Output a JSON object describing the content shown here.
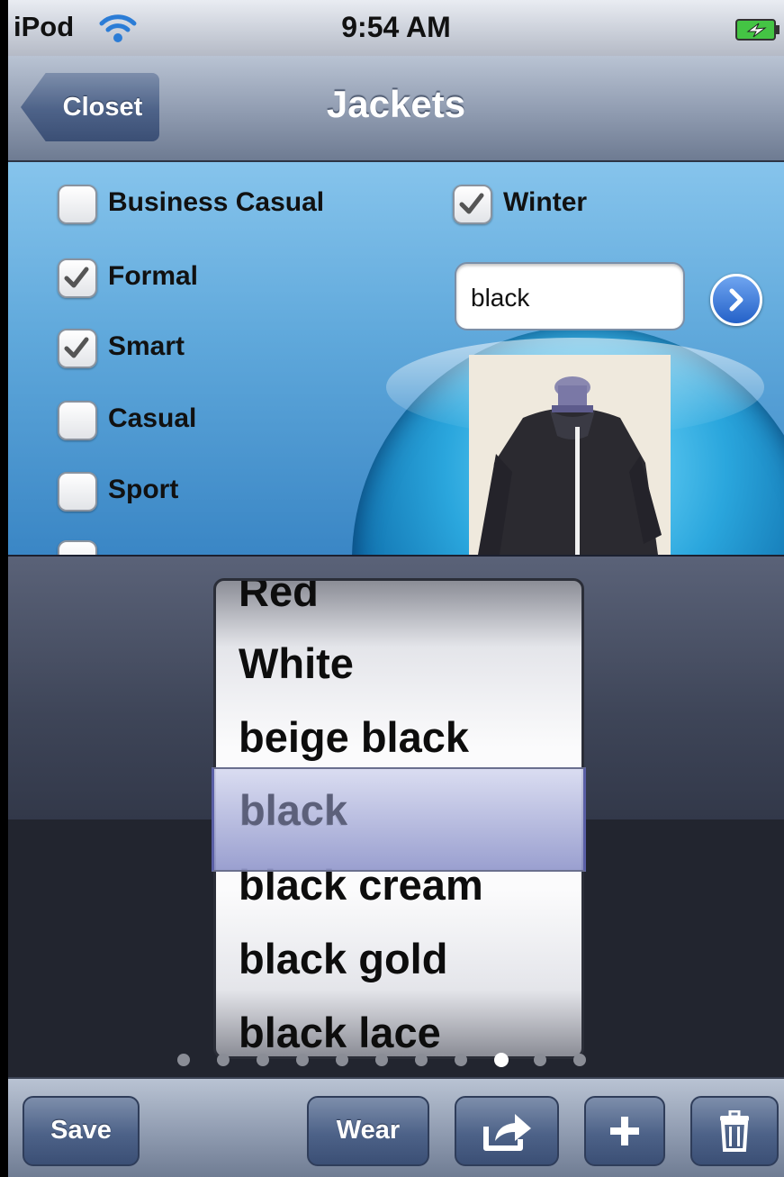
{
  "status_bar": {
    "carrier": "iPod",
    "time": "9:54 AM"
  },
  "nav": {
    "back_label": "Closet",
    "title": "Jackets"
  },
  "filters": {
    "occasions": [
      {
        "label": "Business Casual",
        "checked": false
      },
      {
        "label": "Formal",
        "checked": true
      },
      {
        "label": "Smart",
        "checked": true
      },
      {
        "label": "Casual",
        "checked": false
      },
      {
        "label": "Sport",
        "checked": false
      }
    ],
    "season": {
      "label": "Winter",
      "checked": true
    }
  },
  "color_field": {
    "value": "black"
  },
  "photo": {
    "description": "item-photo"
  },
  "picker": {
    "items": [
      "Red",
      "White",
      "beige black",
      "black",
      "black cream",
      "black gold",
      "black lace"
    ],
    "selected": "black"
  },
  "page_indicator": {
    "count": 11,
    "active_index": 8
  },
  "toolbar": {
    "save_label": "Save",
    "wear_label": "Wear",
    "share_icon": "share-icon",
    "add_icon": "plus-icon",
    "delete_icon": "trash-icon"
  },
  "colors": {
    "nav_gradient_top": "#b9c3d3",
    "button_blue": "#4d6288",
    "content_blue": "#5fa8db",
    "selection_tint": "#9298cc"
  }
}
